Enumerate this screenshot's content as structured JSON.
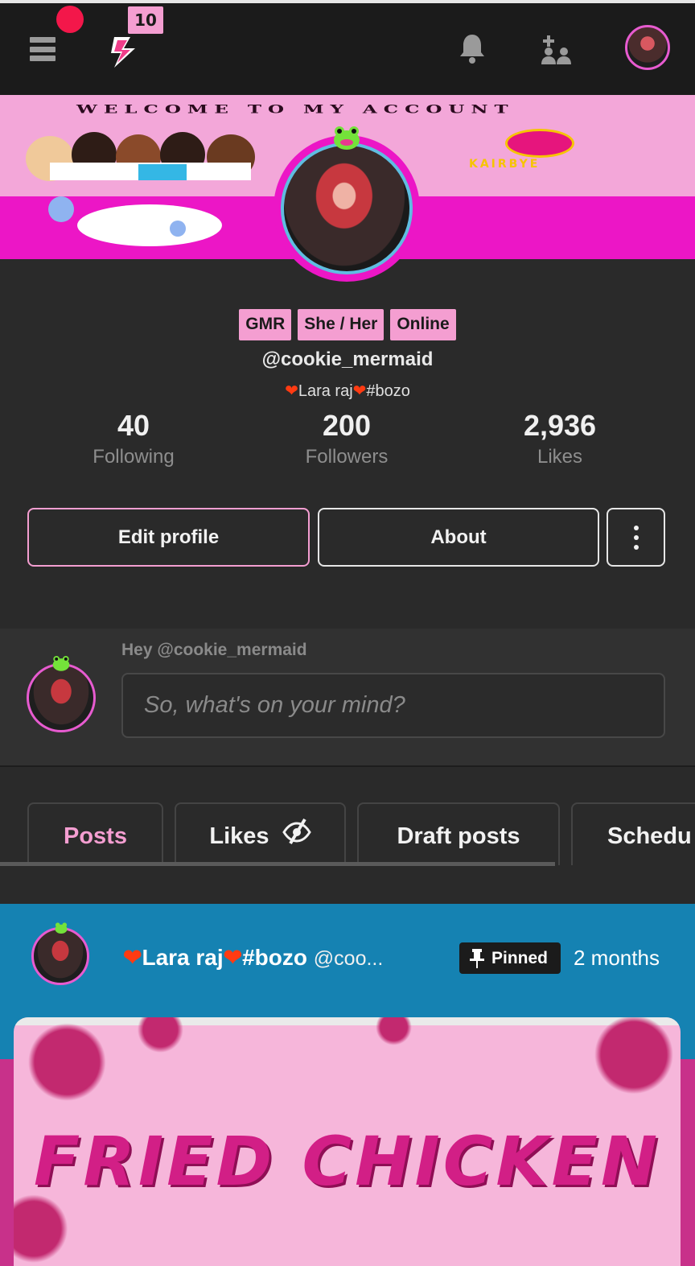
{
  "topbar": {
    "lightning_badge": "10",
    "icons": [
      "menu-icon",
      "lightning-icon",
      "bell-icon",
      "add-user-icon",
      "avatar"
    ]
  },
  "banner": {
    "title": "WELCOME TO MY ACCOUNT",
    "logo_text": "KAIRBYE"
  },
  "profile": {
    "tags": [
      "GMR",
      "She / Her",
      "Online"
    ],
    "handle": "@cookie_mermaid",
    "bio_name": "Lara raj",
    "bio_tag": "#bozo",
    "stats": {
      "following": {
        "value": "40",
        "label": "Following"
      },
      "followers": {
        "value": "200",
        "label": "Followers"
      },
      "likes": {
        "value": "2,936",
        "label": "Likes"
      }
    },
    "buttons": {
      "edit": "Edit profile",
      "about": "About"
    }
  },
  "composer": {
    "greeting": "Hey @cookie_mermaid",
    "placeholder": "So, what's on your mind?"
  },
  "tabs": [
    {
      "label": "Posts",
      "active": true
    },
    {
      "label": "Likes",
      "active": false
    },
    {
      "label": "Draft posts",
      "active": false
    },
    {
      "label": "Schedu",
      "active": false
    }
  ],
  "post": {
    "author_name": "Lara raj",
    "author_tag": "#bozo",
    "author_handle": "@coo...",
    "pinned_label": "Pinned",
    "time": "2 months",
    "image_text": "FRIED CHICKEN"
  },
  "colors": {
    "accent_pink": "#f49ed1",
    "notif_red": "#f3174a",
    "post_blue": "#1582b2",
    "banner_magenta": "#ec16c6"
  }
}
